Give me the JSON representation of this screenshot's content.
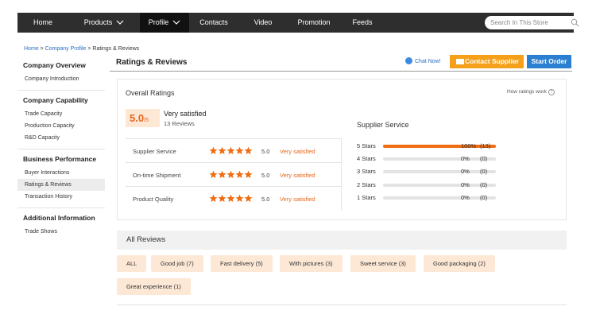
{
  "nav": {
    "items": [
      {
        "label": "Home"
      },
      {
        "label": "Products"
      },
      {
        "label": "Profile"
      },
      {
        "label": "Contacts"
      },
      {
        "label": "Video"
      },
      {
        "label": "Promotion"
      },
      {
        "label": "Feeds"
      }
    ],
    "search_placeholder": "Search In This Store"
  },
  "breadcrumb": {
    "home": "Home",
    "sep1": " > ",
    "profile": "Company Profile",
    "sep2": " > ",
    "current": "Ratings & Reviews"
  },
  "sidebar": {
    "sections": [
      {
        "title": "Company Overview",
        "links": [
          "Company Introduction"
        ]
      },
      {
        "title": "Company Capability",
        "links": [
          "Trade Capacity",
          "Production Capacity",
          "R&D Capacity"
        ]
      },
      {
        "title": "Business Performance",
        "links": [
          "Buyer Interactions",
          "Ratings & Reviews",
          "Transaction History"
        ]
      },
      {
        "title": "Additional Information",
        "links": [
          "Trade Shows"
        ]
      }
    ]
  },
  "header": {
    "title": "Ratings & Reviews",
    "chat_label": "Chat Now!",
    "contact_label": "Contact Supplier",
    "order_label": "Start Order"
  },
  "overall": {
    "title": "Overall Ratings",
    "how_label": "How ratings work",
    "score": "5.0",
    "score_max": "/5",
    "verdict": "Very satisfied",
    "review_count": "13 Reviews"
  },
  "metrics": [
    {
      "label": "Supplier Service",
      "stars": 5,
      "value": "5.0",
      "text": "Very satisfied"
    },
    {
      "label": "On-time Shipment",
      "stars": 5,
      "value": "5.0",
      "text": "Very satisfied"
    },
    {
      "label": "Product Quality",
      "stars": 5,
      "value": "5.0",
      "text": "Very satisfied"
    }
  ],
  "distribution": {
    "title": "Supplier Service",
    "rows": [
      {
        "label": "5 Stars",
        "fraction": 1.0,
        "pct": "100%",
        "count": "(13)"
      },
      {
        "label": "4 Stars",
        "fraction": 0,
        "pct": "0%",
        "count": "(0)"
      },
      {
        "label": "3 Stars",
        "fraction": 0,
        "pct": "0%",
        "count": "(0)"
      },
      {
        "label": "2 Stars",
        "fraction": 0,
        "pct": "0%",
        "count": "(0)"
      },
      {
        "label": "1 Stars",
        "fraction": 0,
        "pct": "0%",
        "count": "(0)"
      }
    ]
  },
  "reviews": {
    "title": "All Reviews",
    "tags": [
      "ALL",
      "Good job (7)",
      "Fast delivery (5)",
      "With pictures (3)",
      "Sweet service (3)",
      "Good packaging (2)",
      "Great experience (1)"
    ]
  },
  "colors": {
    "accent": "#f06d12",
    "star": "#f06d12",
    "contact_button": "#f5a01a",
    "order_button": "#2b7fd0"
  }
}
